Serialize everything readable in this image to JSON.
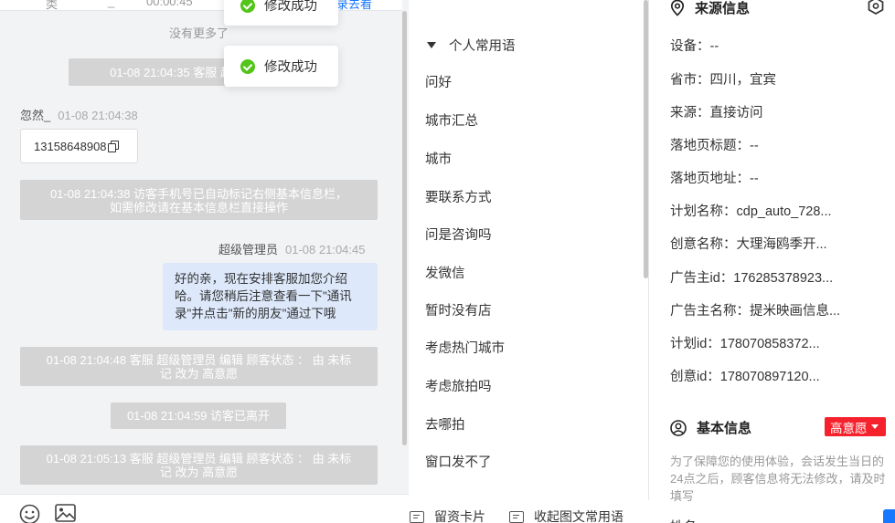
{
  "chat": {
    "top_bar": {
      "left": "类",
      "mid": "_",
      "time": "00:00:45",
      "link": "录去看"
    },
    "no_more": "没有更多了",
    "messages": [
      {
        "type": "system",
        "text": "01-08 21:04:35 客服 超级管"
      },
      {
        "type": "customer_meta",
        "name": "忽然_",
        "time": "01-08 21:04:38"
      },
      {
        "type": "customer_phone",
        "text": "13158648908"
      },
      {
        "type": "system",
        "line1": "01-08 21:04:38 访客手机号已自动标记右侧基本信息栏，",
        "line2": "如需修改请在基本信息栏直接操作"
      },
      {
        "type": "agent_meta",
        "name": "超级管理员",
        "time": "01-08 21:04:45"
      },
      {
        "type": "agent_text",
        "line1": "好的亲，现在安排客服加您介绍",
        "line2": "哈。请您稍后注意查看一下\"通讯",
        "line3": "录\"并点击\"新的朋友\"通过下哦"
      },
      {
        "type": "system",
        "line1": "01-08 21:04:48 客服 超级管理员 编辑 顾客状态 ： 由 未标",
        "line2": "记 改为 高意愿"
      },
      {
        "type": "system",
        "text": "01-08 21:04:59 访客已离开"
      },
      {
        "type": "system",
        "line1": "01-08 21:05:13 客服 超级管理员 编辑 顾客状态 ： 由 未标",
        "line2": "记 改为 高意愿"
      }
    ],
    "toasts": [
      "修改成功",
      "修改成功"
    ]
  },
  "phrases": {
    "group_title": "个人常用语",
    "items": [
      "问好",
      "城市汇总",
      "城市",
      "要联系方式",
      "问是咨询吗",
      "发微信",
      "暂时没有店",
      "考虑热门城市",
      "考虑旅拍吗",
      "去哪拍",
      "窗口发不了"
    ],
    "tools": {
      "card": "留资卡片",
      "collapse": "收起图文常用语"
    }
  },
  "info": {
    "source_title": "来源信息",
    "source_rows": [
      "设备：--",
      "省市：四川，宜宾",
      "来源：直接访问",
      "落地页标题：--",
      "落地页地址：--",
      "计划名称：cdp_auto_728...",
      "创意名称：大理海鸥季开...",
      "广告主id：176285378923...",
      "广告主名称：提米映画信息...",
      "计划id：178070858372...",
      "创意id：178070897120..."
    ],
    "basic_title": "基本信息",
    "intent_badge": "高意愿",
    "notice": "为了保障您的使用体验，会话发生当日的24点之后，顾客信息将无法修改，请及时填写",
    "cut_label": "姓名"
  },
  "colors": {
    "system_bg": "#d4d4d4",
    "agent_bubble": "#dde9fb",
    "badge": "#f5222d",
    "success": "#52c41a"
  }
}
